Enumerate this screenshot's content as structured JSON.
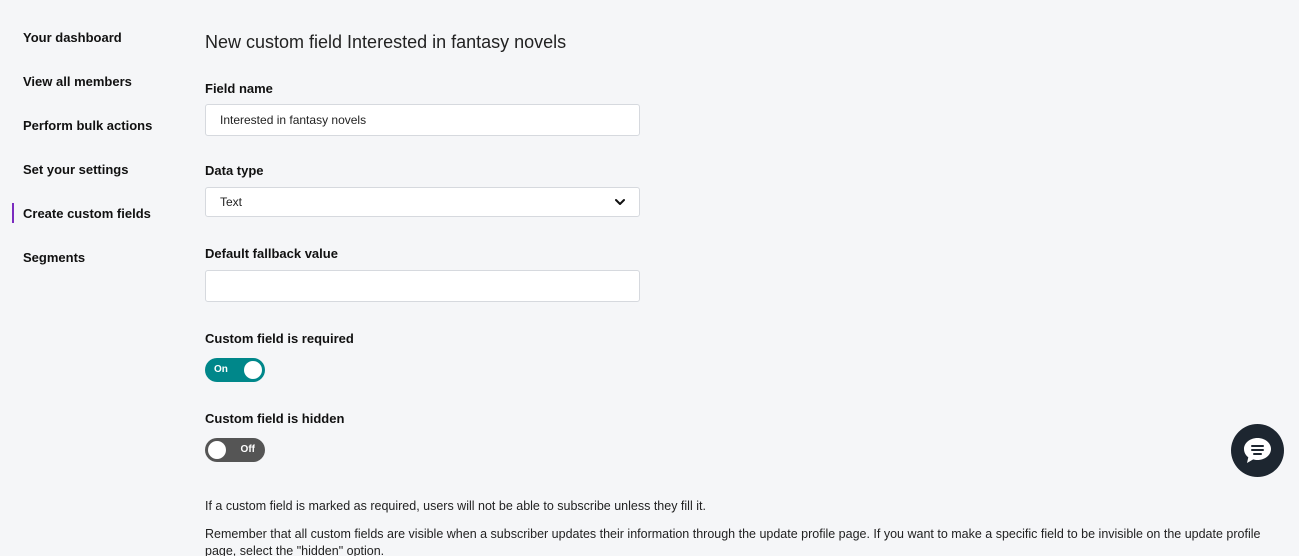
{
  "sidebar": {
    "items": [
      {
        "label": "Your dashboard",
        "active": false
      },
      {
        "label": "View all members",
        "active": false
      },
      {
        "label": "Perform bulk actions",
        "active": false
      },
      {
        "label": "Set your settings",
        "active": false
      },
      {
        "label": "Create custom fields",
        "active": true
      },
      {
        "label": "Segments",
        "active": false
      }
    ],
    "active_indicator_color": "#7b2cbf"
  },
  "main": {
    "title": "New custom field Interested in fantasy novels",
    "field_name": {
      "label": "Field name",
      "value": "Interested in fantasy novels"
    },
    "data_type": {
      "label": "Data type",
      "selected": "Text",
      "icon": "chevron-down-icon"
    },
    "default_fallback": {
      "label": "Default fallback value",
      "value": ""
    },
    "required_toggle": {
      "label": "Custom field is required",
      "state": "On",
      "color": "#00878a"
    },
    "hidden_toggle": {
      "label": "Custom field is hidden",
      "state": "Off",
      "color": "#555555"
    },
    "help": {
      "line1": "If a custom field is marked as required, users will not be able to subscribe unless they fill it.",
      "line2": "Remember that all custom fields are visible when a subscriber updates their information through the update profile page. If you want to make a specific field to be invisible on the update profile page, select the \"hidden\" option."
    }
  },
  "chat": {
    "icon": "chat-bubble-icon",
    "color": "#1d2630"
  }
}
